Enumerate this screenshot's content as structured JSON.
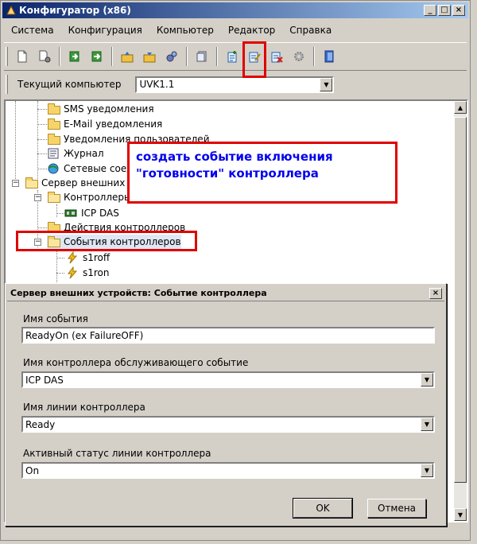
{
  "window": {
    "title": "Конфигуратор (x86)",
    "controls": [
      "_",
      "□",
      "×"
    ]
  },
  "menu": {
    "items": [
      "Система",
      "Конфигурация",
      "Компьютер",
      "Редактор",
      "Справка"
    ]
  },
  "computer_bar": {
    "label": "Текущий компьютер",
    "value": "UVK1.1"
  },
  "tree": {
    "items": [
      {
        "label": "SMS уведомления"
      },
      {
        "label": "E-Mail уведомления"
      },
      {
        "label": "Уведомления пользователей"
      },
      {
        "label": "Журнал"
      },
      {
        "label": "Сетевые соед"
      },
      {
        "label": "Сервер внешних у"
      },
      {
        "label": "Контроллеры"
      },
      {
        "label": "ICP DAS"
      },
      {
        "label": "Действия контроллеров"
      },
      {
        "label": "События контроллеров"
      },
      {
        "label": "s1roff"
      },
      {
        "label": "s1ron"
      }
    ]
  },
  "callout": {
    "line1": "создать событие включения",
    "line2": "\"готовности\" контроллера"
  },
  "dialog": {
    "title": "Сервер внешних устройств: Событие контроллера",
    "close": "×",
    "event_name_label": "Имя события",
    "event_name_value": "ReadyOn (ex FailureOFF)",
    "controller_label": "Имя контроллера обслуживающего событие",
    "controller_value": "ICP DAS",
    "line_label": "Имя линии контроллера",
    "line_value": "Ready",
    "status_label": "Активный статус линии контроллера",
    "status_value": "On",
    "ok_label": "OK",
    "cancel_label": "Отмена"
  },
  "colors": {
    "highlight": "#e00000",
    "callout_text": "#0000ee"
  }
}
